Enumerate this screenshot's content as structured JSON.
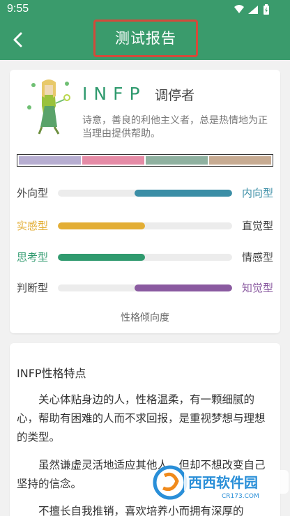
{
  "status": {
    "time": "9:55"
  },
  "header": {
    "title": "测试报告"
  },
  "profile": {
    "code": "INFP",
    "name": "调停者",
    "description": "诗意，善良的利他主义者，总是热情地为正当理由提供帮助。"
  },
  "palette": [
    "#b7aed1",
    "#e58ba6",
    "#8fb1a0",
    "#c7ab92"
  ],
  "dimensions": [
    {
      "left": "外向型",
      "right": "内向型",
      "value": 0.56,
      "side": "right",
      "color": "#3b8ea6",
      "highlight": "right"
    },
    {
      "left": "实感型",
      "right": "直觉型",
      "value": 0.5,
      "side": "left",
      "color": "#e3ae35",
      "highlight": "left"
    },
    {
      "left": "思考型",
      "right": "情感型",
      "value": 0.5,
      "side": "left",
      "color": "#2f9a6e",
      "highlight": "left"
    },
    {
      "left": "判断型",
      "right": "知觉型",
      "value": 0.56,
      "side": "right",
      "color": "#8a5aa0",
      "highlight": "right"
    }
  ],
  "chart_caption": "性格倾向度",
  "traits": {
    "title": "INFP性格特点",
    "paragraphs": [
      "关心体贴身边的人，性格温柔，有一颗细腻的心，帮助有困难的人而不求回报，是重视梦想与理想的类型。",
      "虽然谦虚灵活地适应其他人，但却不想改变自己坚持的信念。",
      "不擅长自我推销，喜欢培养小而拥有深厚的"
    ]
  },
  "watermark": {
    "text": "西西软件园",
    "url": "CR173.COM"
  }
}
